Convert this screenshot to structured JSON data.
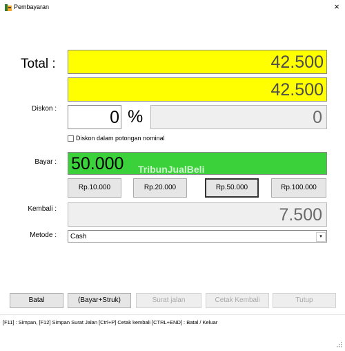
{
  "window": {
    "title": "Pembayaran",
    "close_glyph": "×",
    "icon": "cash-register-icon"
  },
  "labels": {
    "total": "Total :",
    "diskon": "Diskon :",
    "bayar": "Bayar :",
    "kembali": "Kembali :",
    "metode": "Metode :"
  },
  "values": {
    "total": "42.500",
    "after_discount": "42.500",
    "diskon_percent": "0",
    "percent_sign": "%",
    "diskon_nominal": "0",
    "bayar": "50.000",
    "kembali": "7.500"
  },
  "checkbox": {
    "label": "Diskon dalam potongan nominal",
    "checked": false
  },
  "quick_pay": [
    {
      "label": "Rp.10.000",
      "selected": false
    },
    {
      "label": "Rp.20.000",
      "selected": false
    },
    {
      "label": "Rp.50.000",
      "selected": true
    },
    {
      "label": "Rp.100.000",
      "selected": false
    }
  ],
  "metode": {
    "selected": "Cash",
    "arrow": "▾"
  },
  "watermark": "TribunJualBeli",
  "actions": [
    {
      "label": "Batal",
      "enabled": true
    },
    {
      "label": "(Bayar+Struk)",
      "enabled": true
    },
    {
      "label": "Surat jalan",
      "enabled": false
    },
    {
      "label": "Cetak Kembali",
      "enabled": false
    },
    {
      "label": "Tutup",
      "enabled": false
    }
  ],
  "status": "[F11] : Simpan,  [F12] Simpan Surat Jalan  [Ctrl+P] Cetak kembali  [CTRL+END] : Batal / Keluar",
  "colors": {
    "total_bg": "#ffff00",
    "bayar_bg": "#3bd13b"
  }
}
